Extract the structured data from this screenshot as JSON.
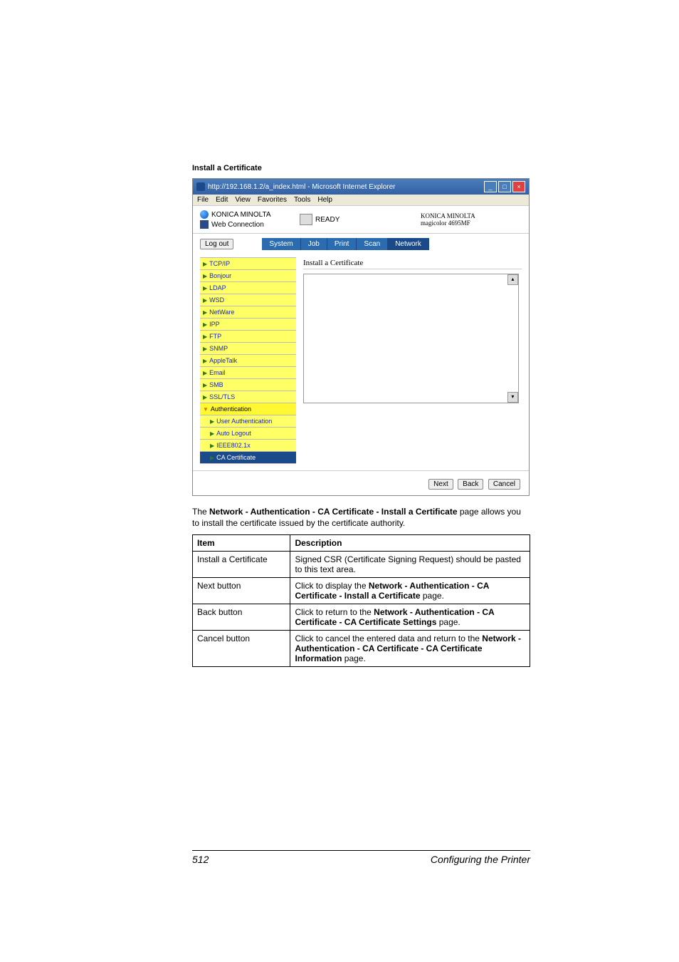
{
  "section_title": "Install a Certificate",
  "browser": {
    "title": "http://192.168.1.2/a_index.html - Microsoft Internet Explorer",
    "menu": [
      "File",
      "Edit",
      "View",
      "Favorites",
      "Tools",
      "Help"
    ]
  },
  "header": {
    "brand": "KONICA MINOLTA",
    "pagescope": "Web Connection",
    "ready": "READY",
    "right1": "KONICA MINOLTA",
    "right2": "magicolor 4695MF",
    "logout": "Log out"
  },
  "tabs": [
    "System",
    "Job",
    "Print",
    "Scan",
    "Network"
  ],
  "active_tab": "Network",
  "nav": [
    {
      "label": "TCP/IP",
      "sub": false,
      "header": false,
      "current": false
    },
    {
      "label": "Bonjour",
      "sub": false,
      "header": false,
      "current": false
    },
    {
      "label": "LDAP",
      "sub": false,
      "header": false,
      "current": false
    },
    {
      "label": "WSD",
      "sub": false,
      "header": false,
      "current": false
    },
    {
      "label": "NetWare",
      "sub": false,
      "header": false,
      "current": false
    },
    {
      "label": "IPP",
      "sub": false,
      "header": false,
      "current": false
    },
    {
      "label": "FTP",
      "sub": false,
      "header": false,
      "current": false
    },
    {
      "label": "SNMP",
      "sub": false,
      "header": false,
      "current": false
    },
    {
      "label": "AppleTalk",
      "sub": false,
      "header": false,
      "current": false
    },
    {
      "label": "Email",
      "sub": false,
      "header": false,
      "current": false
    },
    {
      "label": "SMB",
      "sub": false,
      "header": false,
      "current": false
    },
    {
      "label": "SSL/TLS",
      "sub": false,
      "header": false,
      "current": false
    },
    {
      "label": "Authentication",
      "sub": false,
      "header": true,
      "current": false
    },
    {
      "label": "User Authentication",
      "sub": true,
      "header": false,
      "current": false
    },
    {
      "label": "Auto Logout",
      "sub": true,
      "header": false,
      "current": false
    },
    {
      "label": "IEEE802.1x",
      "sub": true,
      "header": false,
      "current": false
    },
    {
      "label": "CA Certificate",
      "sub": true,
      "header": false,
      "current": true
    }
  ],
  "content": {
    "title": "Install a Certificate"
  },
  "footer_buttons": [
    "Next",
    "Back",
    "Cancel"
  ],
  "caption_intro_1": "The ",
  "caption_bold": "Network - Authentication - CA Certificate - Install a Certificate",
  "caption_intro_2": " page allows you to install the certificate issued by the certificate authority.",
  "table": {
    "head": [
      "Item",
      "Description"
    ],
    "rows": [
      {
        "item": "Install a Certificate",
        "desc": "Signed CSR (Certificate Signing Request) should be pasted to this text area."
      },
      {
        "item": "Next button",
        "desc_pre": "Click to display the ",
        "desc_bold": "Network - Authentication - CA Certificate - Install a Certificate",
        "desc_post": " page."
      },
      {
        "item": "Back button",
        "desc_pre": "Click to return to the ",
        "desc_bold": "Network - Authentication - CA Certificate - CA Certificate Settings",
        "desc_post": " page."
      },
      {
        "item": "Cancel button",
        "desc_pre": "Click to cancel the entered data and return to the ",
        "desc_bold": "Network - Authentication - CA Certificate - CA Certificate Information",
        "desc_post": " page."
      }
    ]
  },
  "page_number": "512",
  "page_section": "Configuring the Printer"
}
